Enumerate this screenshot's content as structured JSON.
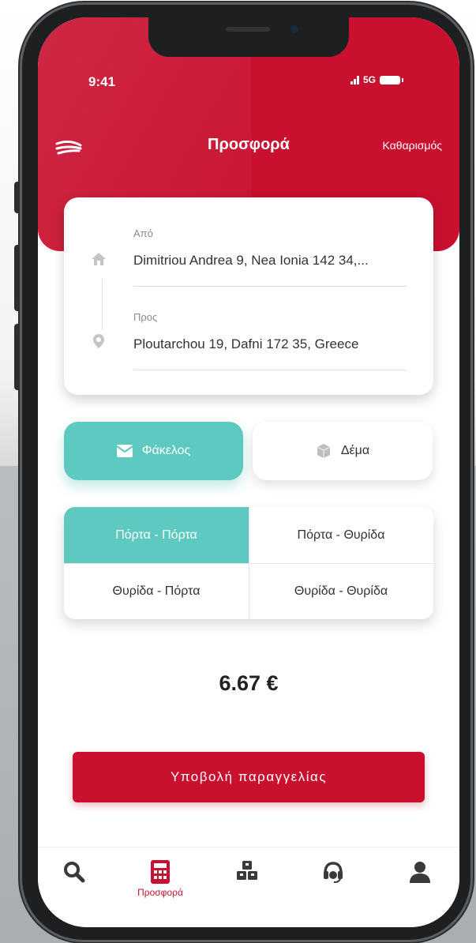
{
  "status_bar": {
    "time": "9:41",
    "network": "5G"
  },
  "header": {
    "title": "Προσφορά",
    "clear_label": "Καθαρισμός"
  },
  "from": {
    "label": "Από",
    "value": "Dimitriou Andrea 9, Nea Ionia 142 34,..."
  },
  "to": {
    "label": "Προς",
    "value": "Ploutarchou 19, Dafni 172 35, Greece"
  },
  "shipment_type": {
    "envelope_label": "Φάκελος",
    "package_label": "Δέμα",
    "selected": "envelope"
  },
  "delivery_mode": {
    "options": [
      "Πόρτα - Πόρτα",
      "Πόρτα - Θυρίδα",
      "Θυρίδα - Πόρτα",
      "Θυρίδα - Θυρίδα"
    ],
    "selected": "Πόρτα - Πόρτα"
  },
  "price": "6.67 €",
  "submit_label": "Υποβολή παραγγελίας",
  "tabbar": {
    "active_label": "Προσφορά",
    "items": [
      "search-icon",
      "calculator-icon",
      "boxes-icon",
      "support-headset-icon",
      "user-icon"
    ]
  },
  "colors": {
    "brand_red": "#c9102f",
    "teal": "#5ec9c1"
  }
}
